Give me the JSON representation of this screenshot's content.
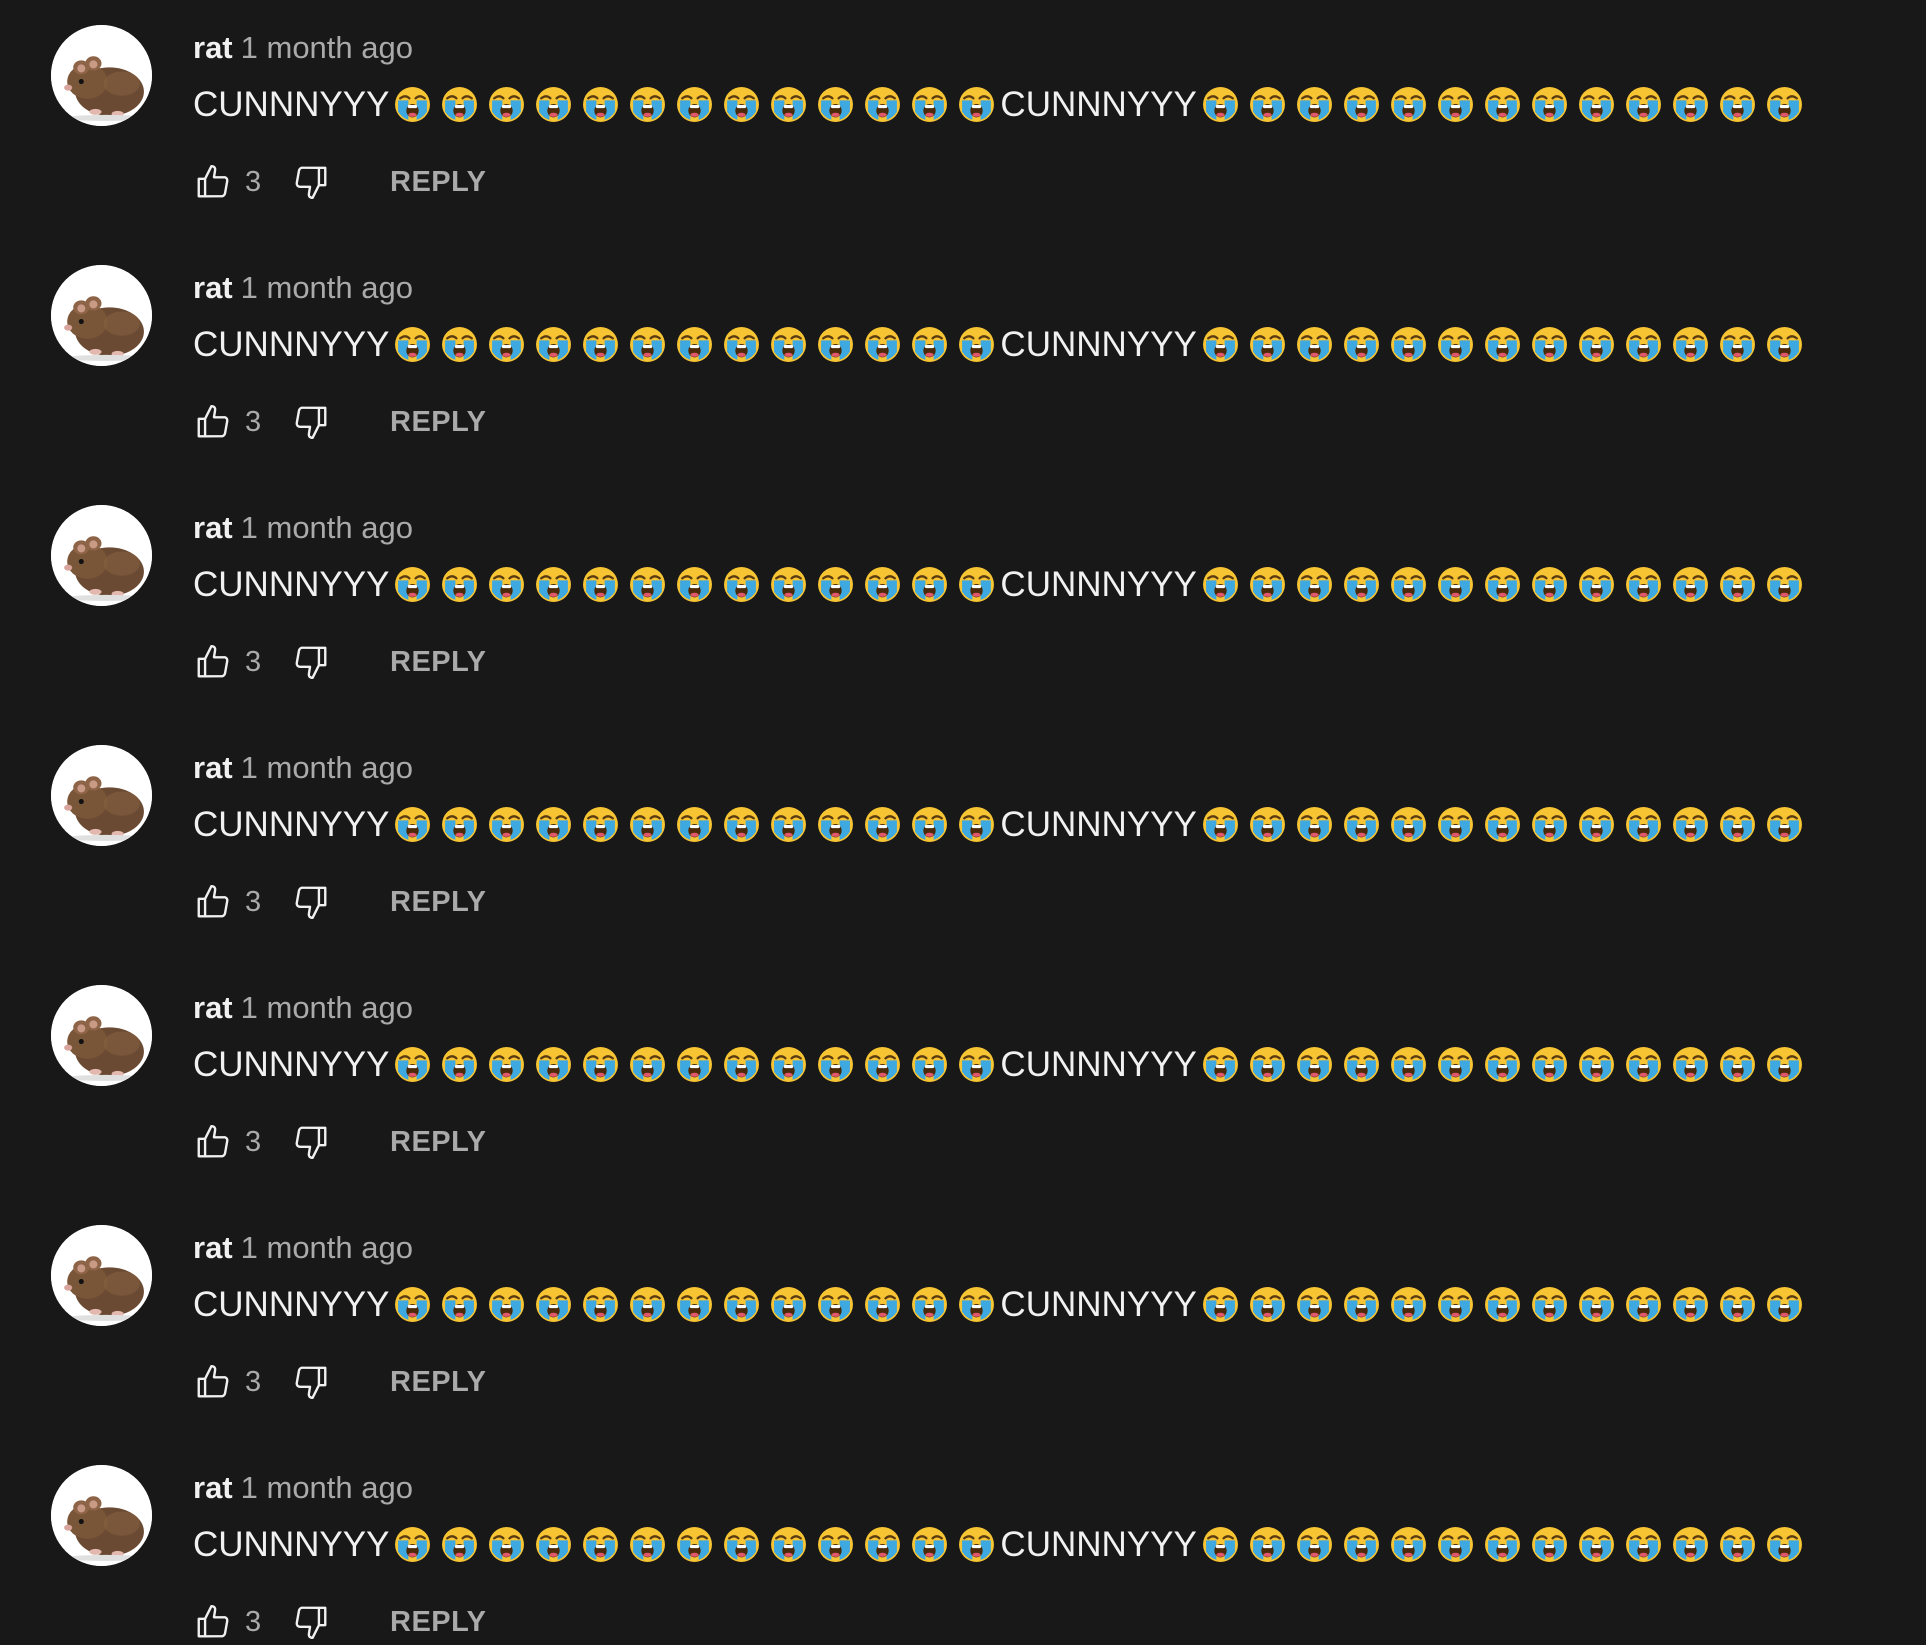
{
  "comments": [
    {
      "author": "rat",
      "time": "1 month ago",
      "text_part1": "CUNNNYYY",
      "emoji_count_1": 13,
      "text_part2": "CUNNNYYY",
      "emoji_count_2": 13,
      "likes": "3",
      "reply_label": "REPLY"
    },
    {
      "author": "rat",
      "time": "1 month ago",
      "text_part1": "CUNNNYYY",
      "emoji_count_1": 13,
      "text_part2": "CUNNNYYY",
      "emoji_count_2": 13,
      "likes": "3",
      "reply_label": "REPLY"
    },
    {
      "author": "rat",
      "time": "1 month ago",
      "text_part1": "CUNNNYYY",
      "emoji_count_1": 13,
      "text_part2": "CUNNNYYY",
      "emoji_count_2": 13,
      "likes": "3",
      "reply_label": "REPLY"
    },
    {
      "author": "rat",
      "time": "1 month ago",
      "text_part1": "CUNNNYYY",
      "emoji_count_1": 13,
      "text_part2": "CUNNNYYY",
      "emoji_count_2": 13,
      "likes": "3",
      "reply_label": "REPLY"
    },
    {
      "author": "rat",
      "time": "1 month ago",
      "text_part1": "CUNNNYYY",
      "emoji_count_1": 13,
      "text_part2": "CUNNNYYY",
      "emoji_count_2": 13,
      "likes": "3",
      "reply_label": "REPLY"
    },
    {
      "author": "rat",
      "time": "1 month ago",
      "text_part1": "CUNNNYYY",
      "emoji_count_1": 13,
      "text_part2": "CUNNNYYY",
      "emoji_count_2": 13,
      "likes": "3",
      "reply_label": "REPLY"
    },
    {
      "author": "rat",
      "time": "1 month ago",
      "text_part1": "CUNNNYYY",
      "emoji_count_1": 13,
      "text_part2": "CUNNNYYY",
      "emoji_count_2": 13,
      "likes": "3",
      "reply_label": "REPLY"
    }
  ],
  "emoji": "loudly-crying-face",
  "icons": {
    "like": "thumbs-up-icon",
    "dislike": "thumbs-down-icon",
    "avatar": "rat-avatar"
  },
  "colors": {
    "background": "#181818",
    "primary_text": "#f1f1f1",
    "secondary_text": "#aaaaaa",
    "emoji_face": "#f7c433",
    "emoji_tears": "#3ea8e0"
  }
}
